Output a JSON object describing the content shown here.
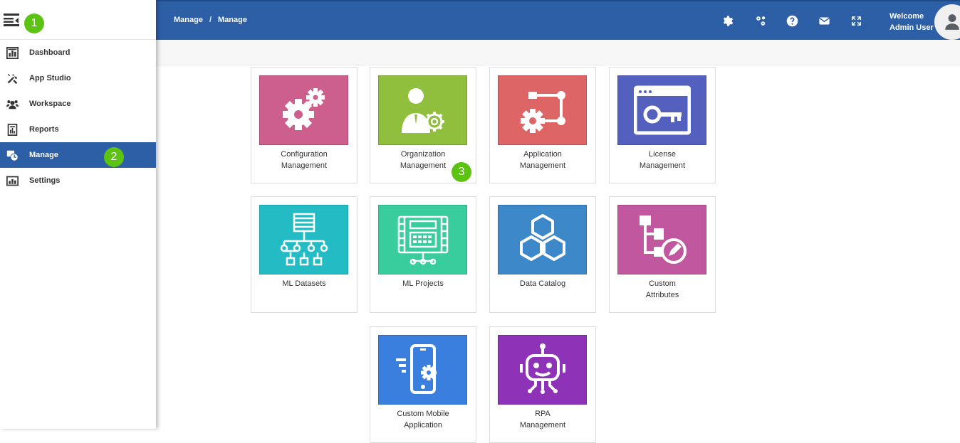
{
  "breadcrumb": {
    "first": "Manage",
    "separator": "/",
    "second": "Manage"
  },
  "header": {
    "welcome": "Welcome",
    "user": "Admin User"
  },
  "badges": [
    "1",
    "2",
    "3"
  ],
  "sidebar": {
    "items": [
      {
        "label": "Dashboard",
        "icon": "dashboard-icon"
      },
      {
        "label": "App Studio",
        "icon": "tools-icon"
      },
      {
        "label": "Workspace",
        "icon": "workspace-icon"
      },
      {
        "label": "Reports",
        "icon": "reports-icon"
      },
      {
        "label": "Manage",
        "icon": "manage-icon",
        "active": true
      },
      {
        "label": "Settings",
        "icon": "settings-icon"
      }
    ]
  },
  "cards": [
    {
      "line1": "Configuration",
      "line2": "Management",
      "color": "#cc5f8c"
    },
    {
      "line1": "Organization",
      "line2": "Management",
      "color": "#8fbf3c"
    },
    {
      "line1": "Application",
      "line2": "Management",
      "color": "#de6566"
    },
    {
      "line1": "License",
      "line2": "Management",
      "color": "#5460bd"
    },
    {
      "line1": "ML Datasets",
      "line2": "",
      "color": "#24bcc4"
    },
    {
      "line1": "ML Projects",
      "line2": "",
      "color": "#39cc9c"
    },
    {
      "line1": "Data Catalog",
      "line2": "",
      "color": "#3d88c9"
    },
    {
      "line1": "Custom",
      "line2": "Attributes",
      "color": "#c1579f"
    },
    {
      "line1": "Custom Mobile",
      "line2": "Application",
      "color": "#3a7fde"
    },
    {
      "line1": "RPA",
      "line2": "Management",
      "color": "#8e33b8"
    }
  ]
}
